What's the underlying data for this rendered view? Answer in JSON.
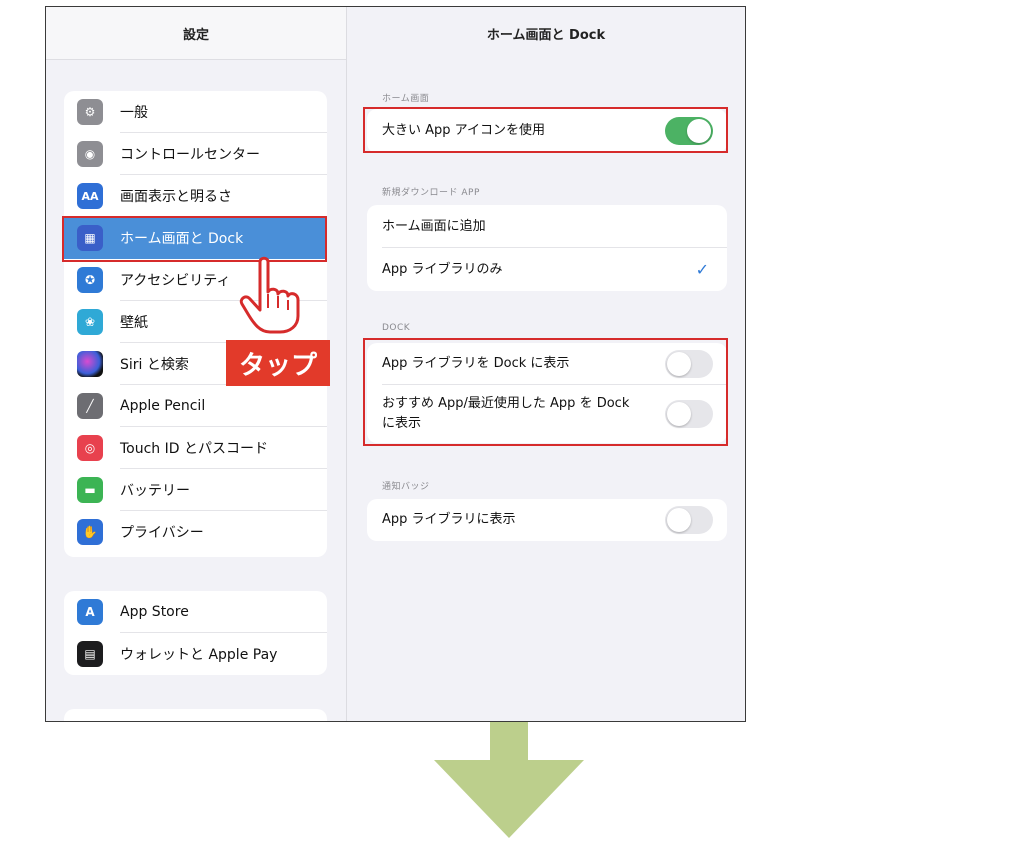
{
  "sidebar": {
    "title": "設定",
    "group1": [
      {
        "label": "一般",
        "icon": "gear-icon",
        "color": "#8e8e93",
        "glyph": "⚙"
      },
      {
        "label": "コントロールセンター",
        "icon": "control-center-icon",
        "color": "#8e8e93",
        "glyph": "◉"
      },
      {
        "label": "画面表示と明るさ",
        "icon": "display-brightness-icon",
        "color": "#2f6fd6",
        "glyph": "AA"
      },
      {
        "label": "ホーム画面と Dock",
        "icon": "home-screen-icon",
        "color": "#3a5fc8",
        "glyph": "▦",
        "selected": true
      },
      {
        "label": "アクセシビリティ",
        "icon": "accessibility-icon",
        "color": "#2f7ad6",
        "glyph": "✪"
      },
      {
        "label": "壁紙",
        "icon": "wallpaper-icon",
        "color": "#2fa9d6",
        "glyph": "❀"
      },
      {
        "label": "Siri と検索",
        "icon": "siri-icon",
        "color": "#222222",
        "glyph": "●"
      },
      {
        "label": "Apple Pencil",
        "icon": "pencil-icon",
        "color": "#6d6d72",
        "glyph": "╱"
      },
      {
        "label": "Touch ID とパスコード",
        "icon": "fingerprint-icon",
        "color": "#e8414e",
        "glyph": "◎"
      },
      {
        "label": "バッテリー",
        "icon": "battery-icon",
        "color": "#3cb454",
        "glyph": "▬"
      },
      {
        "label": "プライバシー",
        "icon": "privacy-hand-icon",
        "color": "#2f6fd6",
        "glyph": "✋"
      }
    ],
    "group2": [
      {
        "label": "App Store",
        "icon": "app-store-icon",
        "color": "#2f7ad6",
        "glyph": "A"
      },
      {
        "label": "ウォレットと Apple Pay",
        "icon": "wallet-icon",
        "color": "#1c1c1e",
        "glyph": "▤"
      }
    ]
  },
  "main": {
    "title": "ホーム画面と Dock",
    "section_home": {
      "label": "ホーム画面",
      "rows": [
        {
          "label": "大きい App アイコンを使用",
          "toggle": true
        }
      ]
    },
    "section_download": {
      "label": "新規ダウンロード APP",
      "rows": [
        {
          "label": "ホーム画面に追加",
          "checked": false
        },
        {
          "label": "App ライブラリのみ",
          "checked": true
        }
      ]
    },
    "section_dock": {
      "label": "DOCK",
      "rows": [
        {
          "label": "App ライブラリを Dock に表示",
          "toggle": false
        },
        {
          "label": "おすすめ App/最近使用した App を Dock に表示",
          "toggle": false
        }
      ]
    },
    "section_badge": {
      "label": "通知バッジ",
      "rows": [
        {
          "label": "App ライブラリに表示",
          "toggle": false
        }
      ]
    },
    "checkmark": "✓"
  },
  "annotation": {
    "tap_label": "タップ",
    "highlight_color": "#d62b2b",
    "arrow_color": "#bccf8c"
  }
}
